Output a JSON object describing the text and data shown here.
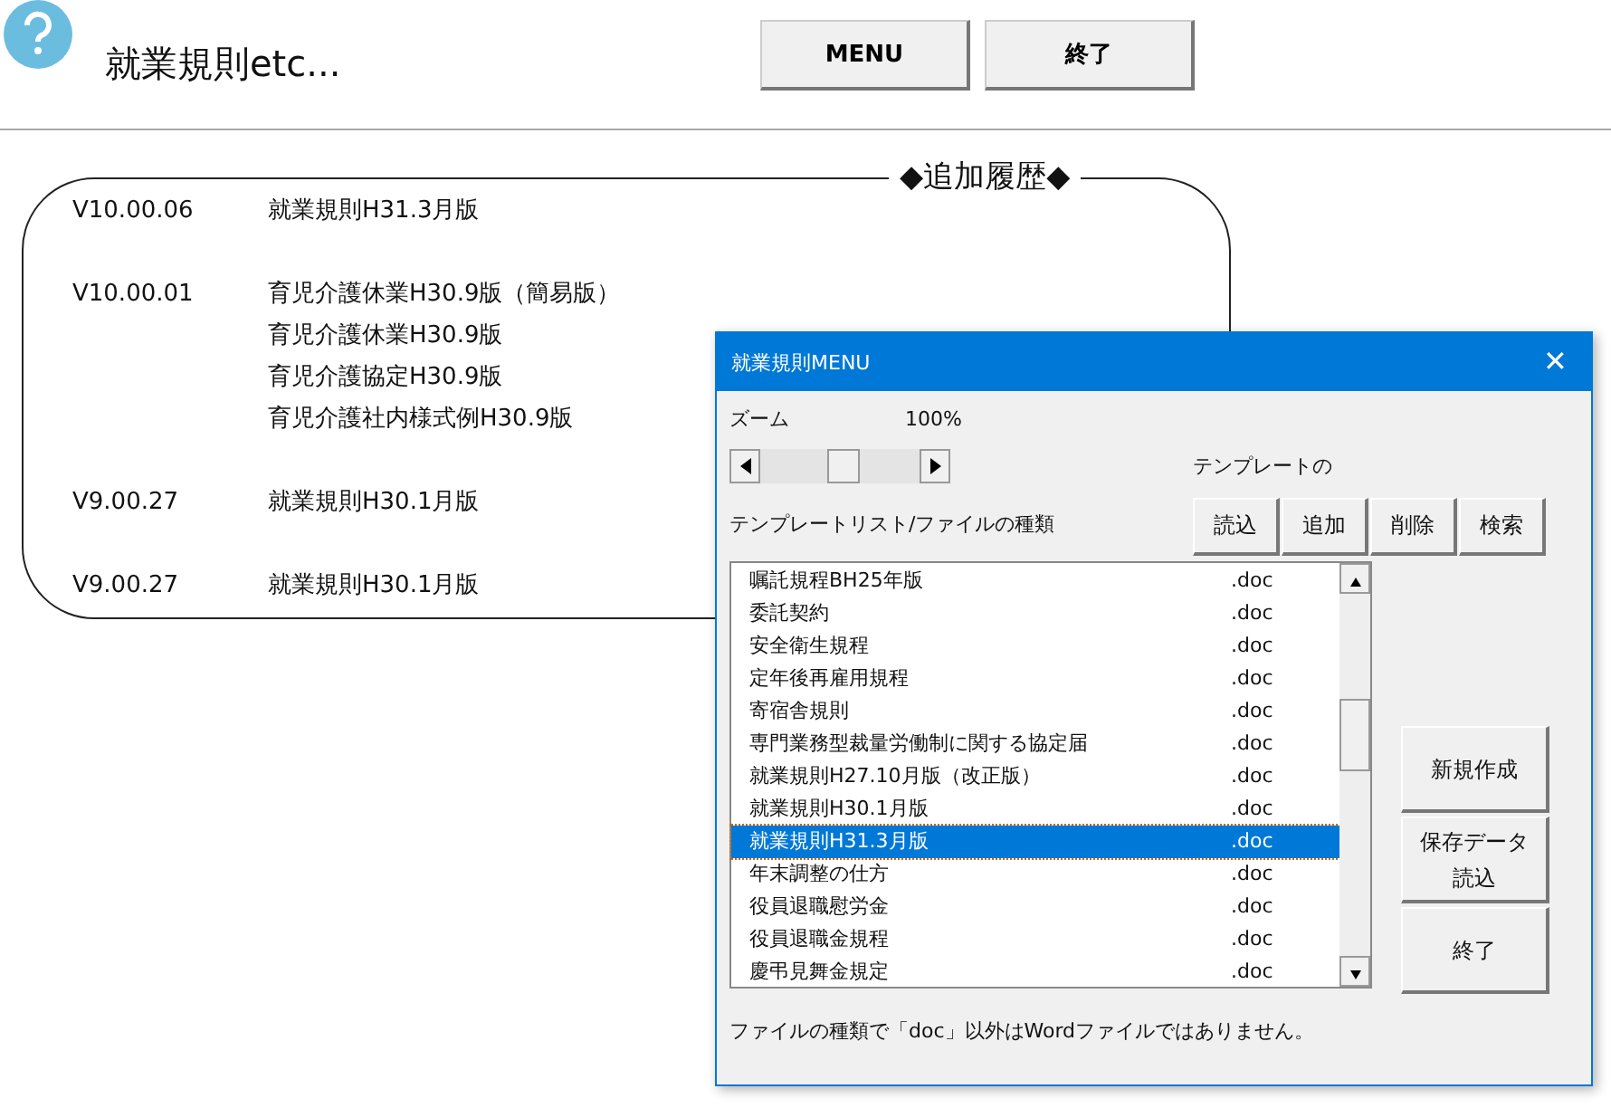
{
  "header": {
    "title": "就業規則etc...",
    "buttons": [
      "MENU",
      "終了"
    ]
  },
  "history": {
    "title": "◆追加履歴◆",
    "entries": [
      {
        "version": "V10.00.06",
        "items": [
          "就業規則H31.3月版"
        ]
      },
      {
        "version": "V10.00.01",
        "items": [
          "育児介護休業H30.9版（簡易版）",
          "育児介護休業H30.9版",
          "育児介護協定H30.9版",
          "育児介護社内様式例H30.9版"
        ]
      },
      {
        "version": "V9.00.27",
        "items": [
          "就業規則H30.1月版"
        ]
      },
      {
        "version": "V9.00.27",
        "items": [
          "就業規則H30.1月版"
        ]
      }
    ]
  },
  "dialog": {
    "title": "就業規則MENU",
    "close": "✕",
    "zoom_label": "ズーム",
    "zoom_value": "100%",
    "zoom_slider": {
      "level": 0.5
    },
    "template_label": "テンプレートの",
    "list_label": "テンプレートリスト/ファイルの種類",
    "template_buttons": [
      "読込",
      "追加",
      "削除",
      "検索"
    ],
    "files": [
      {
        "name": "嘱託規程BH25年版",
        "type": ".doc",
        "selected": false
      },
      {
        "name": "委託契約",
        "type": ".doc",
        "selected": false
      },
      {
        "name": "安全衛生規程",
        "type": ".doc",
        "selected": false
      },
      {
        "name": "定年後再雇用規程",
        "type": ".doc",
        "selected": false
      },
      {
        "name": "寄宿舎規則",
        "type": ".doc",
        "selected": false
      },
      {
        "name": "専門業務型裁量労働制に関する協定届",
        "type": ".doc",
        "selected": false
      },
      {
        "name": "就業規則H27.10月版（改正版）",
        "type": ".doc",
        "selected": false
      },
      {
        "name": "就業規則H30.1月版",
        "type": ".doc",
        "selected": false
      },
      {
        "name": "就業規則H31.3月版",
        "type": ".doc",
        "selected": true
      },
      {
        "name": "年末調整の仕方",
        "type": ".doc",
        "selected": false
      },
      {
        "name": "役員退職慰労金",
        "type": ".doc",
        "selected": false
      },
      {
        "name": "役員退職金規程",
        "type": ".doc",
        "selected": false
      },
      {
        "name": "慶弔見舞金規定",
        "type": ".doc",
        "selected": false
      }
    ],
    "side_buttons": [
      "新規作成",
      "保存データ読込",
      "終了"
    ],
    "note": "ファイルの種類で「doc」以外はWordファイルではありません。"
  }
}
